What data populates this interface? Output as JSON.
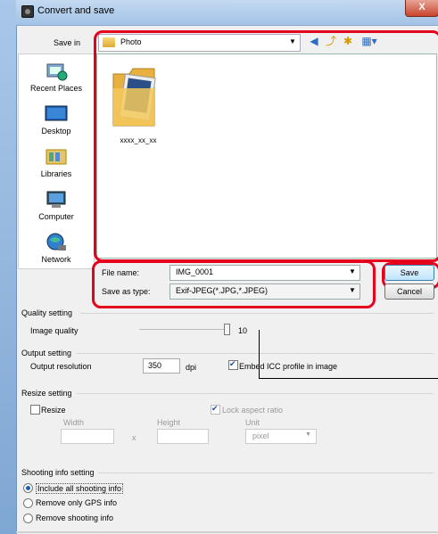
{
  "window": {
    "title": "Convert and save",
    "close_label": "X"
  },
  "save_in": {
    "label": "Save in",
    "value": "Photo"
  },
  "places": [
    {
      "label": "Recent Places",
      "icon": "recent-places-icon"
    },
    {
      "label": "Desktop",
      "icon": "desktop-icon"
    },
    {
      "label": "Libraries",
      "icon": "libraries-icon"
    },
    {
      "label": "Computer",
      "icon": "computer-icon"
    },
    {
      "label": "Network",
      "icon": "network-icon"
    }
  ],
  "file_list": {
    "items": [
      {
        "label": "xxxx_xx_xx",
        "icon": "folder-icon"
      }
    ]
  },
  "file_name": {
    "label": "File name:",
    "value": "IMG_0001"
  },
  "save_as_type": {
    "label": "Save as type:",
    "value": "Exif-JPEG(*.JPG,*.JPEG)"
  },
  "buttons": {
    "save": "Save",
    "cancel": "Cancel"
  },
  "quality": {
    "title": "Quality setting",
    "label": "Image quality",
    "value": "10",
    "level": 10,
    "max": 10
  },
  "output": {
    "title": "Output setting",
    "label": "Output resolution",
    "value": "350",
    "unit": "dpi",
    "embed_icc_label": "Embed ICC profile in image",
    "embed_icc_checked": true
  },
  "resize": {
    "title": "Resize setting",
    "resize_label": "Resize",
    "resize_checked": false,
    "lock_label": "Lock aspect ratio",
    "lock_checked": true,
    "width_label": "Width",
    "height_label": "Height",
    "times": "x",
    "unit_label": "Unit",
    "unit_value": "pixel"
  },
  "shooting": {
    "title": "Shooting info setting",
    "options": [
      "Include all shooting info",
      "Remove only GPS info",
      "Remove shooting info"
    ],
    "selected": 0
  },
  "colors": {
    "highlight": "#e5001e",
    "title_bar": "#a2c2e6"
  }
}
